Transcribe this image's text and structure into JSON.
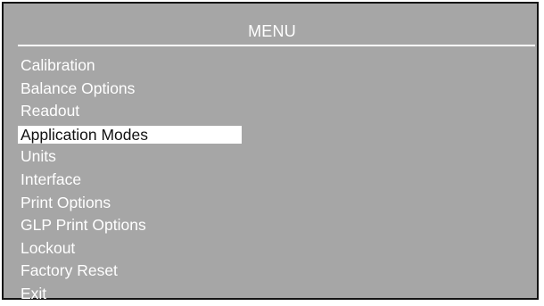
{
  "menu": {
    "title": "MENU",
    "selected_index": 3,
    "items": [
      {
        "label": "Calibration"
      },
      {
        "label": "Balance Options"
      },
      {
        "label": "Readout"
      },
      {
        "label": "Application Modes"
      },
      {
        "label": "Units"
      },
      {
        "label": "Interface"
      },
      {
        "label": "Print Options"
      },
      {
        "label": "GLP Print Options"
      },
      {
        "label": "Lockout"
      },
      {
        "label": "Factory Reset"
      },
      {
        "label": "Exit"
      }
    ]
  },
  "colors": {
    "background": "#a6a6a6",
    "text": "#ffffff",
    "highlight_background": "#ffffff",
    "highlight_text": "#111111",
    "border": "#141414"
  }
}
